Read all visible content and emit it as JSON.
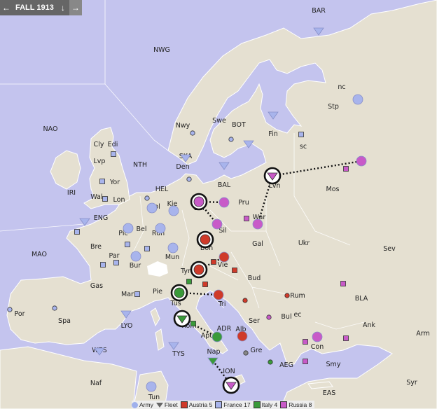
{
  "phase": {
    "label": "FALL 1913",
    "prev_icon": "arrow-left-icon",
    "next_icon": "arrow-right-icon"
  },
  "colors": {
    "land": "#e5e0d1",
    "sea": "#c4c4ee",
    "austria": "#cf3a2a",
    "france": "#a8b4ec",
    "italy": "#3a9a3a",
    "russia": "#c85ac8"
  },
  "regions": [
    {
      "name": "NWG"
    },
    {
      "name": "BAR"
    },
    {
      "name": "NAO"
    },
    {
      "name": "Cly"
    },
    {
      "name": "Edi"
    },
    {
      "name": "Lvp"
    },
    {
      "name": "Yor"
    },
    {
      "name": "Wal"
    },
    {
      "name": "Lon"
    },
    {
      "name": "IRI"
    },
    {
      "name": "ENG"
    },
    {
      "name": "NTH"
    },
    {
      "name": "HEL"
    },
    {
      "name": "Hol"
    },
    {
      "name": "Bel"
    },
    {
      "name": "Pic"
    },
    {
      "name": "Bre"
    },
    {
      "name": "Par"
    },
    {
      "name": "Bur"
    },
    {
      "name": "Ruh"
    },
    {
      "name": "Kie"
    },
    {
      "name": "Den"
    },
    {
      "name": "SKA"
    },
    {
      "name": "Nwy"
    },
    {
      "name": "Swe"
    },
    {
      "name": "BOT"
    },
    {
      "name": "Fin"
    },
    {
      "name": "Stp"
    },
    {
      "name": "nc"
    },
    {
      "name": "sc"
    },
    {
      "name": "BAL"
    },
    {
      "name": "Ber"
    },
    {
      "name": "Pru"
    },
    {
      "name": "Sil"
    },
    {
      "name": "War"
    },
    {
      "name": "Lvn"
    },
    {
      "name": "Mos"
    },
    {
      "name": "Ukr"
    },
    {
      "name": "Sev"
    },
    {
      "name": "Gal"
    },
    {
      "name": "Boh"
    },
    {
      "name": "Mun"
    },
    {
      "name": "Tyr"
    },
    {
      "name": "Vie"
    },
    {
      "name": "Bud"
    },
    {
      "name": "Tri"
    },
    {
      "name": "Rum"
    },
    {
      "name": "Ser"
    },
    {
      "name": "Bul"
    },
    {
      "name": "ec"
    },
    {
      "name": "BLA"
    },
    {
      "name": "Ank"
    },
    {
      "name": "Arm"
    },
    {
      "name": "Con"
    },
    {
      "name": "Smy"
    },
    {
      "name": "Syr"
    },
    {
      "name": "AEG"
    },
    {
      "name": "EAS"
    },
    {
      "name": "Gre"
    },
    {
      "name": "Alb"
    },
    {
      "name": "ADR"
    },
    {
      "name": "Apu"
    },
    {
      "name": "Nap"
    },
    {
      "name": "ION"
    },
    {
      "name": "Rom"
    },
    {
      "name": "Tus"
    },
    {
      "name": "Ven"
    },
    {
      "name": "Pie"
    },
    {
      "name": "Mar"
    },
    {
      "name": "Gas"
    },
    {
      "name": "Spa"
    },
    {
      "name": "Por"
    },
    {
      "name": "MAO"
    },
    {
      "name": "LYO"
    },
    {
      "name": "WES"
    },
    {
      "name": "TYS"
    },
    {
      "name": "Naf"
    },
    {
      "name": "Tun"
    }
  ],
  "legend": [
    {
      "label": "Army",
      "type": "army"
    },
    {
      "label": "Fleet",
      "type": "fleet"
    },
    {
      "label": "Austria 5",
      "color": "#cf3a2a"
    },
    {
      "label": "France 17",
      "color": "#a8b4ec"
    },
    {
      "label": "Italy 4",
      "color": "#3a9a3a"
    },
    {
      "label": "Russia 8",
      "color": "#c85ac8"
    }
  ]
}
